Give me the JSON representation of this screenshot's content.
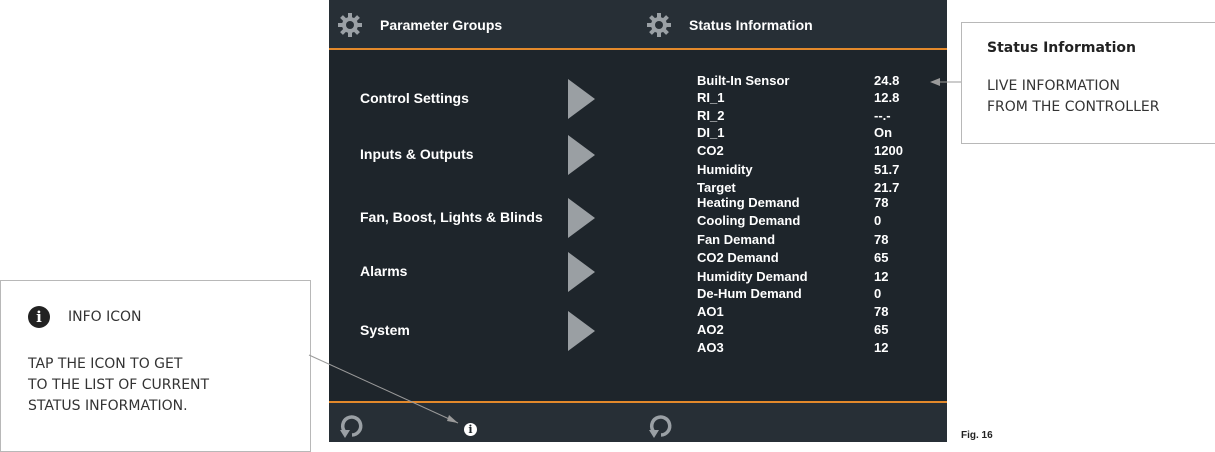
{
  "parameter_groups": {
    "title": "Parameter Groups",
    "items": [
      {
        "label": "Control Settings"
      },
      {
        "label": "Inputs & Outputs"
      },
      {
        "label": "Fan, Boost, Lights & Blinds"
      },
      {
        "label": "Alarms"
      },
      {
        "label": "System"
      }
    ],
    "info_glyph": "i"
  },
  "status": {
    "title": "Status Information",
    "rows": [
      {
        "name": "Built-In Sensor",
        "value": "24.8"
      },
      {
        "name": "RI_1",
        "value": "12.8"
      },
      {
        "name": "RI_2",
        "value": "--.-"
      },
      {
        "name": "DI_1",
        "value": "On"
      },
      {
        "name": "CO2",
        "value": "1200"
      },
      {
        "name": "Humidity",
        "value": "51.7"
      },
      {
        "name": "Target",
        "value": "21.7"
      },
      {
        "name": "Heating Demand",
        "value": "78"
      },
      {
        "name": "Cooling Demand",
        "value": "0"
      },
      {
        "name": "Fan Demand",
        "value": "78"
      },
      {
        "name": "CO2 Demand",
        "value": "65"
      },
      {
        "name": "Humidity Demand",
        "value": "12"
      },
      {
        "name": "De-Hum Demand",
        "value": "0"
      },
      {
        "name": "AO1",
        "value": "78"
      },
      {
        "name": "AO2",
        "value": "65"
      },
      {
        "name": "AO3",
        "value": "12"
      }
    ]
  },
  "callout_info": {
    "title": "INFO ICON",
    "icon_glyph": "i",
    "lines": [
      "TAP THE ICON TO GET",
      "TO THE LIST OF CURRENT",
      "STATUS INFORMATION."
    ]
  },
  "callout_status": {
    "title": "Status Information",
    "lines": [
      "LIVE INFORMATION",
      "FROM THE CONTROLLER"
    ]
  },
  "figure_label": "Fig. 16",
  "icons": {
    "header": "gear-icon",
    "footer": "refresh-icon",
    "info": "info-icon",
    "menu_arrow": "chevron-right-icon"
  },
  "colors": {
    "screen_bg": "#1e252b",
    "accent": "#e3892b",
    "arrow": "#9a9fa3",
    "text": "#ffffff"
  }
}
